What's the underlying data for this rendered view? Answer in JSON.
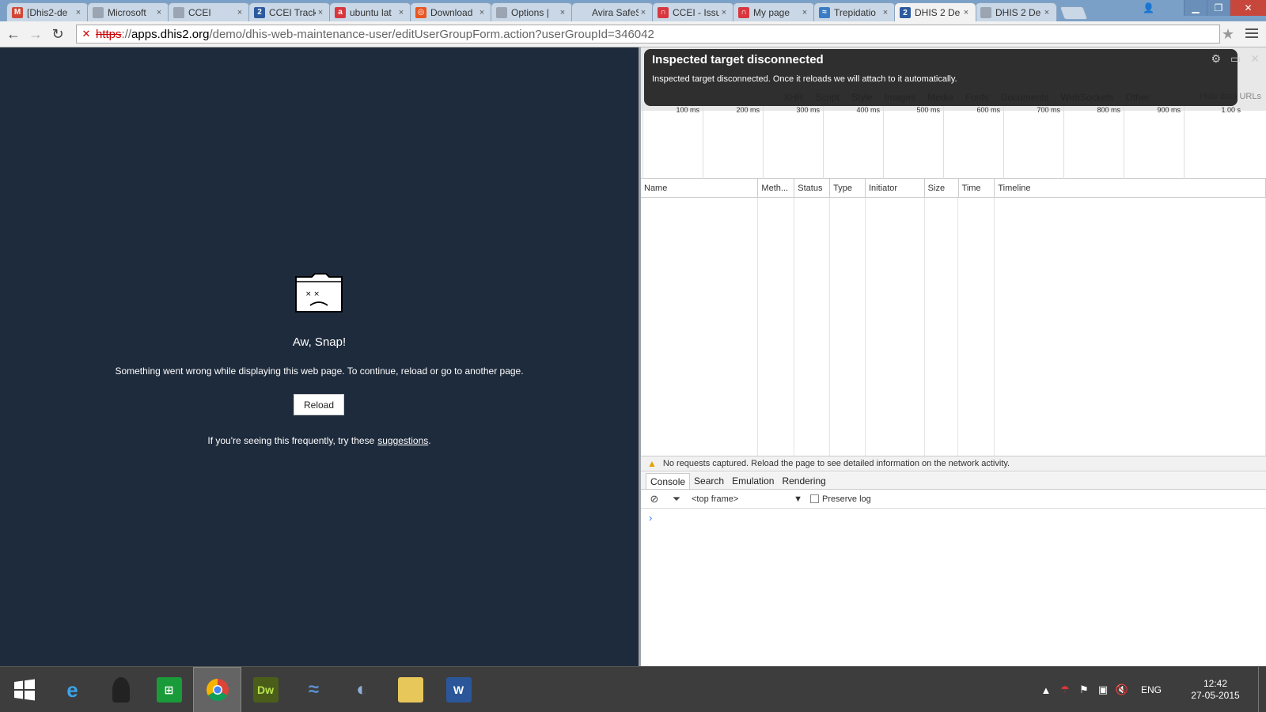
{
  "tabs": [
    {
      "title": "[Dhis2-de",
      "fav_color": "#d14836",
      "fav_glyph": "M",
      "active": false
    },
    {
      "title": "Microsoft",
      "fav_color": "#9aa5b1",
      "fav_glyph": "",
      "active": false
    },
    {
      "title": "CCEI",
      "fav_color": "#9aa5b1",
      "fav_glyph": "",
      "active": false
    },
    {
      "title": "CCEI Track",
      "fav_color": "#2c5aa0",
      "fav_glyph": "2",
      "active": false
    },
    {
      "title": "ubuntu lat",
      "fav_color": "#d9363e",
      "fav_glyph": "a",
      "active": false
    },
    {
      "title": "Download",
      "fav_color": "#e95420",
      "fav_glyph": "◎",
      "active": false
    },
    {
      "title": "Options |",
      "fav_color": "#9aa5b1",
      "fav_glyph": "",
      "active": false
    },
    {
      "title": "Avira SafeSe",
      "fav_color": "#c9d7e6",
      "fav_glyph": "",
      "active": false
    },
    {
      "title": "CCEI - Issu",
      "fav_color": "#d9363e",
      "fav_glyph": "∩",
      "active": false
    },
    {
      "title": "My page",
      "fav_color": "#d9363e",
      "fav_glyph": "∩",
      "active": false
    },
    {
      "title": "Trepidatio",
      "fav_color": "#3b7dc4",
      "fav_glyph": "≈",
      "active": false
    },
    {
      "title": "DHIS 2 De",
      "fav_color": "#2c5aa0",
      "fav_glyph": "2",
      "active": true
    },
    {
      "title": "DHIS 2 De",
      "fav_color": "#9aa5b1",
      "fav_glyph": "",
      "active": false
    }
  ],
  "tab_close_glyph": "×",
  "address": {
    "scheme": "https",
    "scheme_sep": "://",
    "host": "apps.dhis2.org",
    "path": "/demo/dhis-web-maintenance-user/editUserGroupForm.action?userGroupId=346042"
  },
  "page": {
    "title": "Aw, Snap!",
    "message": "Something went wrong while displaying this web page. To continue, reload or go to another page.",
    "reload_label": "Reload",
    "suggest_prefix": "If you're seeing this frequently, try these",
    "suggest_link": "suggestions",
    "suggest_suffix": "."
  },
  "devtools": {
    "toast_title": "Inspected target disconnected",
    "toast_message": "Inspected target disconnected. Once it reloads we will attach to it automatically.",
    "filter_types": [
      "XHR",
      "Script",
      "Style",
      "Images",
      "Media",
      "Fonts",
      "Documents",
      "WebSockets",
      "Other"
    ],
    "hide_data_urls": "Hide data URLs",
    "timeline_ticks": [
      "100 ms",
      "200 ms",
      "300 ms",
      "400 ms",
      "500 ms",
      "600 ms",
      "700 ms",
      "800 ms",
      "900 ms",
      "1.00 s"
    ],
    "columns": [
      "Name",
      "Meth...",
      "Status",
      "Type",
      "Initiator",
      "Size",
      "Time",
      "Timeline"
    ],
    "warning": "No requests captured. Reload the page to see detailed information on the network activity.",
    "drawer_tabs": [
      "Console",
      "Search",
      "Emulation",
      "Rendering"
    ],
    "frame_selector": "<top frame>",
    "preserve_log": "Preserve log",
    "prompt": "›"
  },
  "tray": {
    "lang": "ENG",
    "time": "12:42",
    "date": "27-05-2015"
  }
}
